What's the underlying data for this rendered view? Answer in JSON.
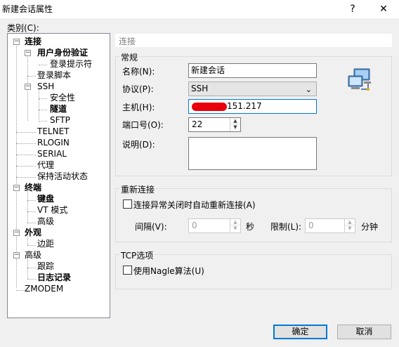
{
  "window": {
    "title": "新建会话属性",
    "help": "?",
    "close": "✕"
  },
  "category_label": "类别(C):",
  "tree": [
    {
      "label": "连接",
      "bold": true,
      "toggle": "−"
    },
    {
      "label": "用户身份验证",
      "bold": true,
      "toggle": "−"
    },
    {
      "label": "登录提示符",
      "bold": false
    },
    {
      "label": "登录脚本",
      "bold": false
    },
    {
      "label": "SSH",
      "bold": false,
      "toggle": "−"
    },
    {
      "label": "安全性",
      "bold": false
    },
    {
      "label": "隧道",
      "bold": true
    },
    {
      "label": "SFTP",
      "bold": false
    },
    {
      "label": "TELNET",
      "bold": false
    },
    {
      "label": "RLOGIN",
      "bold": false
    },
    {
      "label": "SERIAL",
      "bold": false
    },
    {
      "label": "代理",
      "bold": false
    },
    {
      "label": "保持活动状态",
      "bold": false
    },
    {
      "label": "终端",
      "bold": true,
      "toggle": "−"
    },
    {
      "label": "键盘",
      "bold": true
    },
    {
      "label": "VT 模式",
      "bold": false
    },
    {
      "label": "高级",
      "bold": false
    },
    {
      "label": "外观",
      "bold": true,
      "toggle": "−"
    },
    {
      "label": "边距",
      "bold": false
    },
    {
      "label": "高级",
      "bold": false,
      "toggle": "−"
    },
    {
      "label": "跟踪",
      "bold": false
    },
    {
      "label": "日志记录",
      "bold": true
    },
    {
      "label": "ZMODEM",
      "bold": false
    }
  ],
  "panel_title": "连接",
  "general": {
    "group_label": "常规",
    "name_label": "名称(N):",
    "name_value": "新建会话",
    "protocol_label": "协议(P):",
    "protocol_value": "SSH",
    "host_label": "主机(H):",
    "host_value": "151.217",
    "port_label": "端口号(O):",
    "port_value": "22",
    "desc_label": "说明(D):",
    "desc_value": ""
  },
  "reconnect": {
    "group_label": "重新连接",
    "checkbox_label": "连接异常关闭时自动重新连接(A)",
    "interval_label": "间隔(V):",
    "interval_value": "0",
    "interval_unit": "秒",
    "limit_label": "限制(L):",
    "limit_value": "0",
    "limit_unit": "分钟"
  },
  "tcp": {
    "group_label": "TCP选项",
    "checkbox_label": "使用Nagle算法(U)"
  },
  "buttons": {
    "ok": "确定",
    "cancel": "取消"
  }
}
